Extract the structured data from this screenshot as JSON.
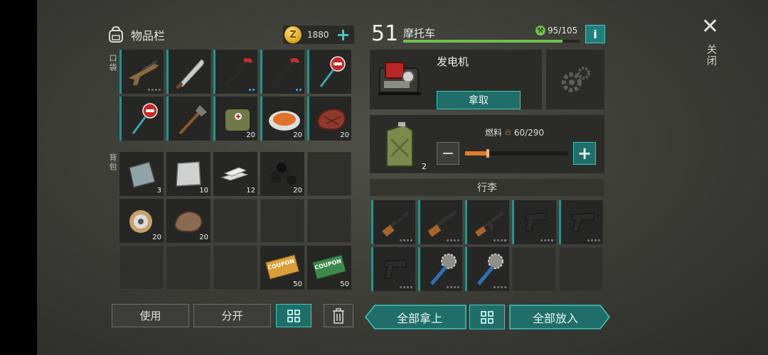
{
  "inventory": {
    "title": "物品栏",
    "coins": "1880",
    "pocket_label": "口袋",
    "backpack_label": "背包",
    "pocket_slots": [
      {
        "icon": "assault-rifle-icon",
        "qty": "",
        "dots": "gggg"
      },
      {
        "icon": "machete-icon",
        "qty": "",
        "dots": ""
      },
      {
        "icon": "crowbar-icon",
        "qty": "",
        "dots": "bb"
      },
      {
        "icon": "crowbar-icon",
        "qty": "",
        "dots": "bb"
      },
      {
        "icon": "stop-sign-icon",
        "qty": "",
        "dots": ""
      },
      {
        "icon": "stop-sign-icon",
        "qty": "",
        "dots": ""
      },
      {
        "icon": "shovel-icon",
        "qty": "",
        "dots": ""
      },
      {
        "icon": "medkit-bag-icon",
        "qty": "20",
        "dots": ""
      },
      {
        "icon": "food-plate-icon",
        "qty": "20",
        "dots": ""
      },
      {
        "icon": "steak-icon",
        "qty": "20",
        "dots": ""
      }
    ],
    "backpack_slots": [
      {
        "icon": "metal-sheet-icon",
        "qty": "3"
      },
      {
        "icon": "aluminum-plate-icon",
        "qty": "10"
      },
      {
        "icon": "iron-bars-icon",
        "qty": "12"
      },
      {
        "icon": "coal-icon",
        "qty": "20"
      },
      {
        "icon": "",
        "qty": ""
      },
      {
        "icon": "wire-spool-icon",
        "qty": "20"
      },
      {
        "icon": "ore-rock-icon",
        "qty": "20"
      },
      {
        "icon": "",
        "qty": ""
      },
      {
        "icon": "",
        "qty": ""
      },
      {
        "icon": "",
        "qty": ""
      },
      {
        "icon": "",
        "qty": ""
      },
      {
        "icon": "",
        "qty": ""
      },
      {
        "icon": "",
        "qty": ""
      },
      {
        "icon": "coupon-orange-icon",
        "qty": "50",
        "text": "COUPON"
      },
      {
        "icon": "coupon-green-icon",
        "qty": "50",
        "text": "COUPON"
      }
    ],
    "use_label": "使用",
    "split_label": "分开"
  },
  "vehicle": {
    "level": "51",
    "name": "摩托车",
    "hp_text": "95/105",
    "hp_fraction": 0.905,
    "generator_name": "发电机",
    "take_label": "拿取",
    "fuel_label": "燃料",
    "fuel_text": "60/290",
    "fuel_fraction": 0.207,
    "fuel_qty": "2",
    "luggage_label": "行李",
    "luggage_slots": [
      {
        "icon": "rifle-scoped-icon",
        "dots": "gggg"
      },
      {
        "icon": "shotgun-icon",
        "dots": "gggg"
      },
      {
        "icon": "ak-rifle-icon",
        "dots": "gggp"
      },
      {
        "icon": "pistol-icon",
        "dots": "gggp"
      },
      {
        "icon": "pistol-icon",
        "dots": "gggg"
      },
      {
        "icon": "pistol-icon",
        "dots": "gggg"
      },
      {
        "icon": "spiked-mace-icon",
        "dots": "gggg"
      },
      {
        "icon": "spiked-mace-icon",
        "dots": "gggg"
      },
      {
        "icon": "",
        "dots": ""
      },
      {
        "icon": "",
        "dots": ""
      }
    ],
    "take_all_label": "全部拿上",
    "put_all_label": "全部放入"
  },
  "close_label": "关闭",
  "colors": {
    "accent": "#3fc7bd",
    "hp": "#6ec14e",
    "fuel": "#e07a2c"
  }
}
